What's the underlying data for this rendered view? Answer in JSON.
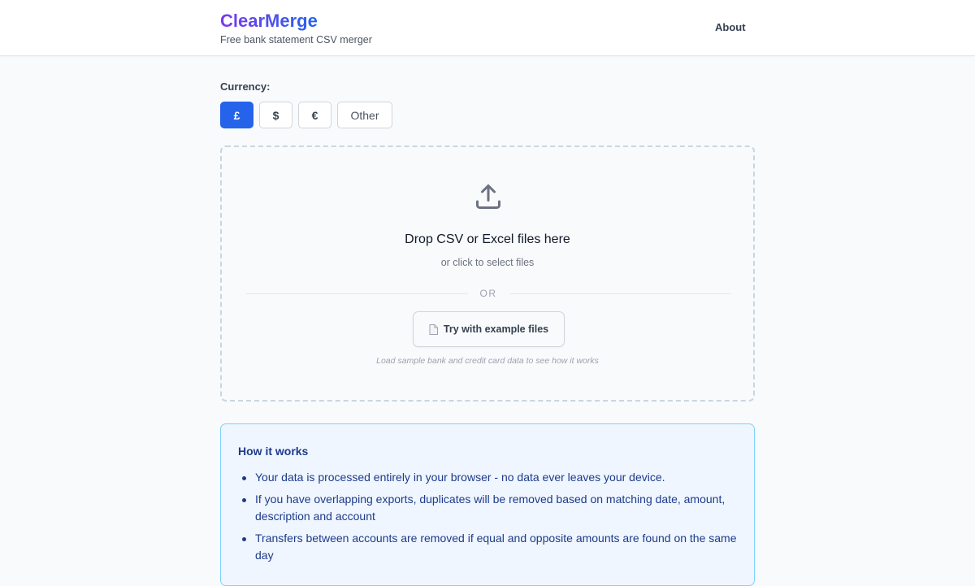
{
  "header": {
    "brand": "ClearMerge",
    "tagline": "Free bank statement CSV merger",
    "nav_about": "About"
  },
  "currency": {
    "label": "Currency:",
    "options": [
      "£",
      "$",
      "€",
      "Other"
    ],
    "selected": "£"
  },
  "dropzone": {
    "title": "Drop CSV or Excel files here",
    "subtitle": "or click to select files",
    "divider": "OR",
    "example_button": "Try with example files",
    "hint": "Load sample bank and credit card data to see how it works"
  },
  "how_it_works": {
    "title": "How it works",
    "items": [
      "Your data is processed entirely in your browser - no data ever leaves your device.",
      "If you have overlapping exports, duplicates will be removed based on matching date, amount, description and account",
      "Transfers between accounts are removed if equal and opposite amounts are found on the same day"
    ]
  },
  "colors": {
    "accent": "#2563eb",
    "brand_gradient_start": "#7c3aed",
    "brand_gradient_end": "#2563eb",
    "info_text": "#1e3a8a",
    "info_bg": "#eff6ff"
  },
  "icons": {
    "upload": "upload-tray-icon",
    "example_file": "document-icon"
  }
}
